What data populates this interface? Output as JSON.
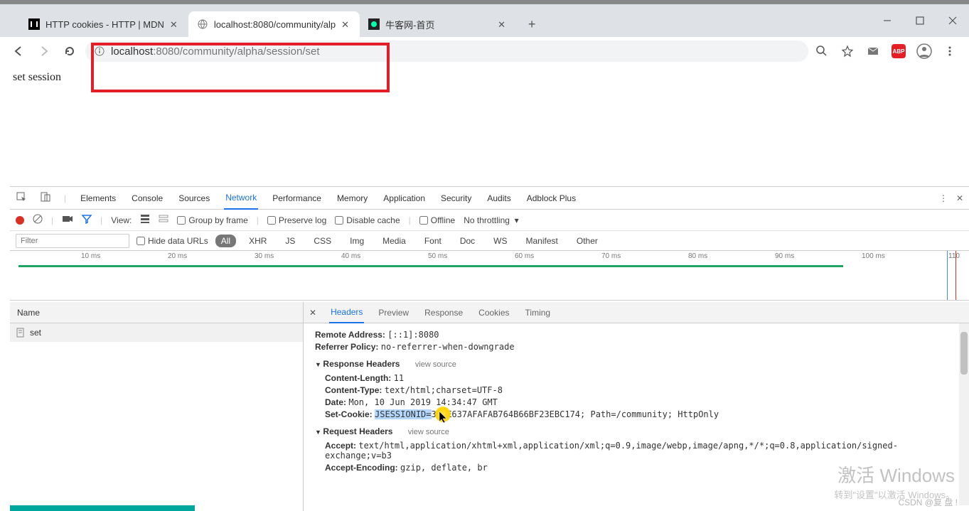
{
  "tabs": [
    {
      "title": "HTTP cookies - HTTP | MDN"
    },
    {
      "title": "localhost:8080/community/alp"
    },
    {
      "title": "牛客网-首页"
    }
  ],
  "omnibox": {
    "host": "localhost",
    "port_path": ":8080/community/alpha/session/set"
  },
  "page": {
    "body_text": "set session"
  },
  "devtools": {
    "tabs": [
      "Elements",
      "Console",
      "Sources",
      "Network",
      "Performance",
      "Memory",
      "Application",
      "Security",
      "Audits",
      "Adblock Plus"
    ],
    "active_tab": "Network",
    "toolbar2": {
      "view_label": "View:",
      "group_by_frame": "Group by frame",
      "preserve_log": "Preserve log",
      "disable_cache": "Disable cache",
      "offline": "Offline",
      "throttling": "No throttling"
    },
    "filter": {
      "placeholder": "Filter",
      "hide_data_urls": "Hide data URLs",
      "types": [
        "All",
        "XHR",
        "JS",
        "CSS",
        "Img",
        "Media",
        "Font",
        "Doc",
        "WS",
        "Manifest",
        "Other"
      ],
      "active_type": "All"
    },
    "timeline_marks": [
      "10 ms",
      "20 ms",
      "30 ms",
      "40 ms",
      "50 ms",
      "60 ms",
      "70 ms",
      "80 ms",
      "90 ms",
      "100 ms",
      "110"
    ],
    "names": {
      "header": "Name",
      "items": [
        "set"
      ]
    },
    "details": {
      "tabs": [
        "Headers",
        "Preview",
        "Response",
        "Cookies",
        "Timing"
      ],
      "active": "Headers",
      "general": {
        "remote_address_label": "Remote Address:",
        "remote_address": "[::1]:8080",
        "referrer_policy_label": "Referrer Policy:",
        "referrer_policy": "no-referrer-when-downgrade"
      },
      "response_headers_title": "Response Headers",
      "view_source": "view source",
      "response_headers": {
        "content_length_label": "Content-Length:",
        "content_length": "11",
        "content_type_label": "Content-Type:",
        "content_type": "text/html;charset=UTF-8",
        "date_label": "Date:",
        "date": "Mon, 10 Jun 2019 14:34:47 GMT",
        "set_cookie_label": "Set-Cookie:",
        "set_cookie_sel": "JSESSIONID=",
        "set_cookie_rest": "348E637AFAFAB764B66BF23EBC174; Path=/community; HttpOnly"
      },
      "request_headers_title": "Request Headers",
      "request_headers": {
        "accept_label": "Accept:",
        "accept": "text/html,application/xhtml+xml,application/xml;q=0.9,image/webp,image/apng,*/*;q=0.8,application/signed-exchange;v=b3",
        "accept_encoding_label": "Accept-Encoding:",
        "accept_encoding": "gzip, deflate, br"
      }
    }
  },
  "watermark": {
    "big": "激活 Windows",
    "small": "转到\"设置\"以激活 Windows。"
  },
  "csdn": "CSDN @复 盘 !"
}
